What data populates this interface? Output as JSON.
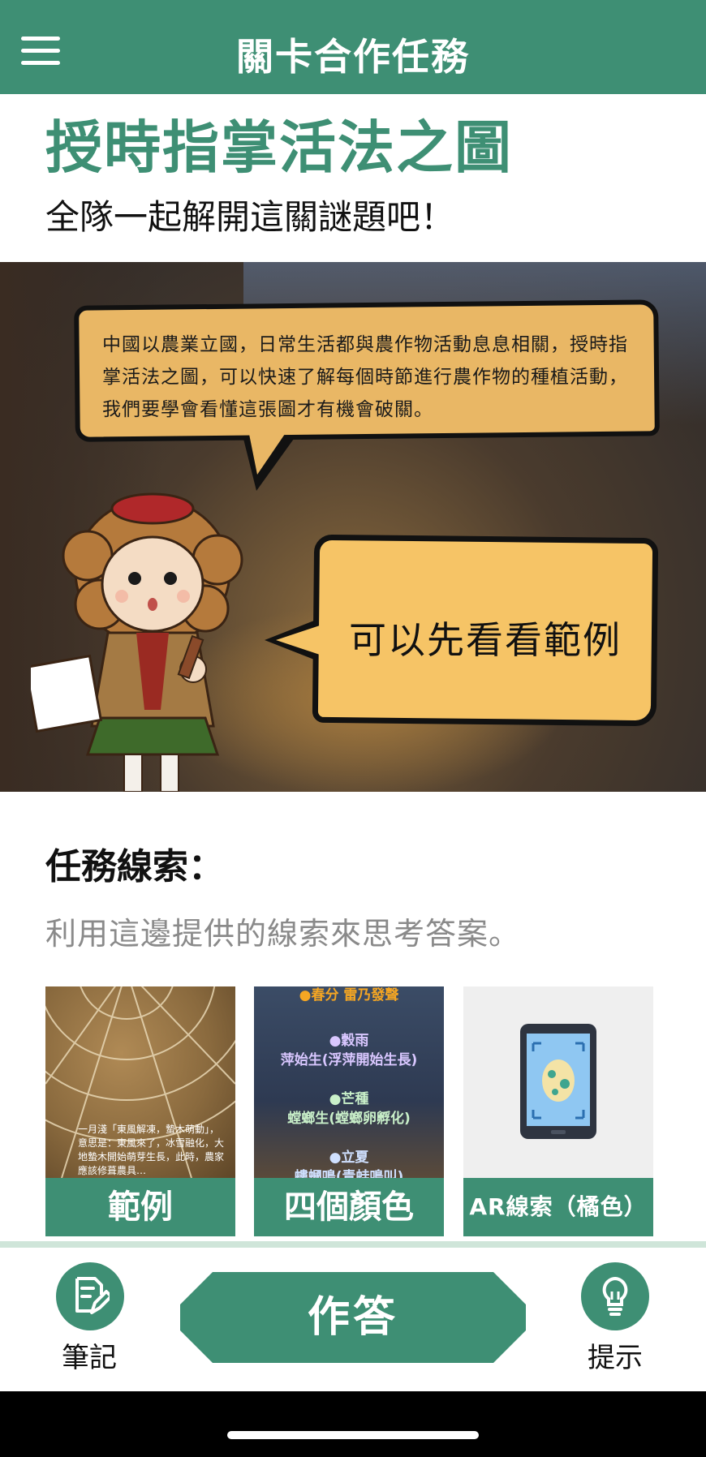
{
  "header": {
    "title": "關卡合作任務",
    "menu_icon": "hamburger-menu-icon"
  },
  "stage": {
    "title": "授時指掌活法之圖",
    "subtitle": "全隊一起解開這關謎題吧！"
  },
  "banner": {
    "intro_text": "中國以農業立國，日常生活都與農作物活動息息相關，授時指掌活法之圖，可以快速了解每個時節進行農作物的種植活動，我們要學會看懂這張圖才有機會破關。",
    "hint_bubble": "可以先看看範例"
  },
  "clues": {
    "heading": "任務線索：",
    "description": "利用這邊提供的線索來思考答案。",
    "cards": [
      {
        "label": "範例",
        "image_text": "一月淺「東風解凍，蟄木萌動」，意思是：東風來了，冰雪融化，大地蟄木開始萌芽生長，此時，農家應該修葺農具…"
      },
      {
        "label": "四個顏色",
        "image_lines": [
          "●春分 雷乃發聲",
          "●穀雨",
          "萍始生(浮萍開始生長)",
          "●芒種",
          "螳螂生(螳螂卵孵化)",
          "●立夏",
          "螻蟈鳴(青蛙鳴叫)"
        ]
      },
      {
        "label": "AR線索（橘色）",
        "image_icon": "ar-phone-egg-icon"
      }
    ]
  },
  "bottom": {
    "note_label": "筆記",
    "answer_label": "作答",
    "hint_label": "提示"
  },
  "colors": {
    "primary": "#3e8f74",
    "bubble": "#f6c466",
    "clue_gray": "#8a8a8a"
  }
}
